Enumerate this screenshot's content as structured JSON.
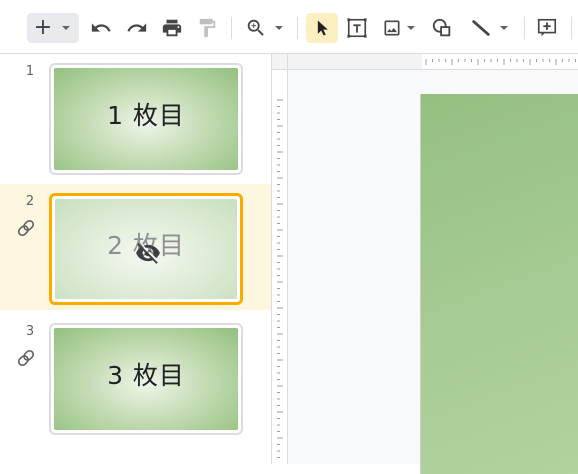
{
  "toolbar": {
    "buttons": [
      {
        "name": "new-slide-button",
        "icon": "plus-icon",
        "label": "+"
      },
      {
        "name": "new-slide-layout-dropdown",
        "icon": "chevron-down-icon"
      },
      {
        "name": "undo-button",
        "icon": "undo-icon"
      },
      {
        "name": "redo-button",
        "icon": "redo-icon"
      },
      {
        "name": "print-button",
        "icon": "print-icon"
      },
      {
        "name": "paint-format-button",
        "icon": "paint-format-icon"
      },
      {
        "name": "zoom-button",
        "icon": "zoom-in-icon"
      },
      {
        "name": "select-tool-button",
        "icon": "cursor-icon",
        "active": true
      },
      {
        "name": "text-box-button",
        "icon": "text-box-icon"
      },
      {
        "name": "insert-image-button",
        "icon": "image-icon"
      },
      {
        "name": "shape-button",
        "icon": "shape-icon"
      },
      {
        "name": "line-button",
        "icon": "line-icon"
      },
      {
        "name": "comment-button",
        "icon": "add-comment-icon"
      }
    ]
  },
  "filmstrip": {
    "slides": [
      {
        "number": "1",
        "title": "1 枚目",
        "linked": false,
        "hidden": false,
        "selected": false
      },
      {
        "number": "2",
        "title": "2 枚目",
        "linked": true,
        "hidden": true,
        "selected": true
      },
      {
        "number": "3",
        "title": "3 枚目",
        "linked": true,
        "hidden": false,
        "selected": false
      }
    ]
  },
  "colors": {
    "selection_border": "#f9ab00",
    "selection_bg": "#fef7e0",
    "active_tool_bg": "#feefc3",
    "slide_green_dark": "#92c07e",
    "slide_green_light": "#eef5e8"
  }
}
